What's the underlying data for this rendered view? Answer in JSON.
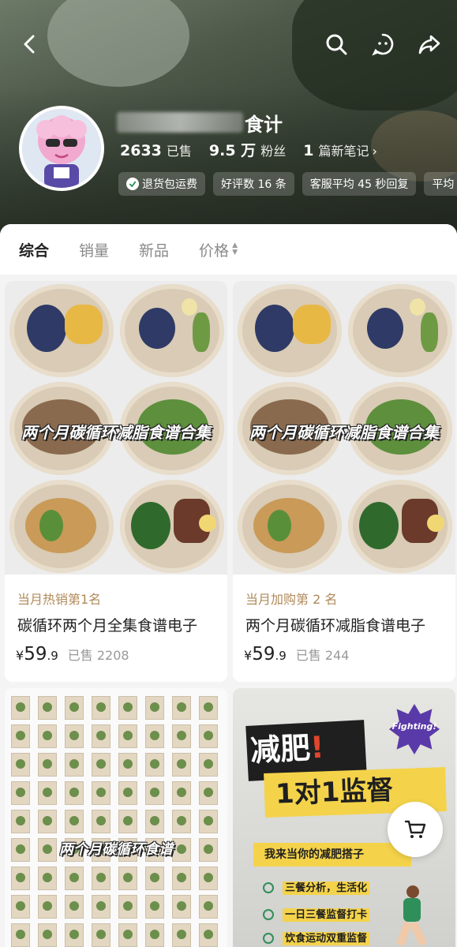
{
  "shop": {
    "name": "食计",
    "sold_count": "2633",
    "sold_label": "已售",
    "fans_count": "9.5 万",
    "fans_label": "粉丝",
    "notes_count": "1",
    "notes_label": "篇新笔记",
    "notes_arrow": "›",
    "tags": [
      "退货包运费",
      "好评数 16 条",
      "客服平均 45 秒回复",
      "平均"
    ]
  },
  "filters": [
    {
      "label": "综合",
      "active": true
    },
    {
      "label": "销量",
      "active": false
    },
    {
      "label": "新品",
      "active": false
    },
    {
      "label": "价格",
      "active": false
    }
  ],
  "products": [
    {
      "overlay": "两个月碳循环减脂食谱合集",
      "badge": "当月热销第1名",
      "title": "碳循环两个月全集食谱电子",
      "currency": "¥",
      "price_int": "59",
      "price_dec": ".9",
      "sold": "已售 2208"
    },
    {
      "overlay": "两个月碳循环减脂食谱合集",
      "badge": "当月加购第 2 名",
      "title": "两个月碳循环减脂食谱电子",
      "currency": "¥",
      "price_int": "59",
      "price_dec": ".9",
      "sold": "已售 244"
    },
    {
      "overlay": "两个月碳循环食谱"
    },
    {
      "headline1": "减肥",
      "headline_mark": "!",
      "headline2": "1对1监督",
      "sticker": "Fighting!",
      "subtitle": "我来当你的减肥搭子",
      "items": [
        "三餐分析，生活化",
        "一日三餐监督打卡",
        "饮食运动双重监督"
      ]
    }
  ],
  "colors": {
    "accent_green": "#2f8f5a",
    "badge_gold": "#b08a5a",
    "promo_yellow": "#f4d34a",
    "promo_red": "#e2452e"
  }
}
